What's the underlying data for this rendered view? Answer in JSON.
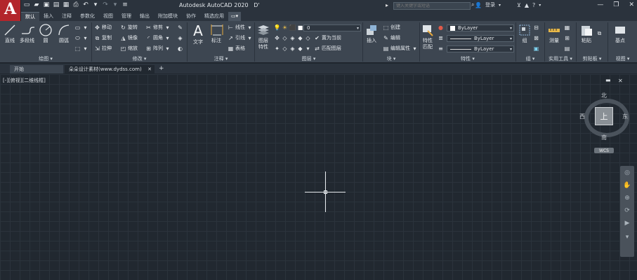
{
  "app": {
    "logo_letter": "A",
    "title": "Autodesk AutoCAD 2020",
    "title_suffix": "D'",
    "search_placeholder": "键入关键字或短语",
    "login_label": "登录"
  },
  "ribbon_tabs": [
    "默认",
    "插入",
    "注释",
    "参数化",
    "视图",
    "管理",
    "输出",
    "附加模块",
    "协作",
    "精选应用"
  ],
  "active_tab_index": 0,
  "draw_panel": {
    "title": "绘图",
    "line": "直线",
    "polyline": "多段线",
    "circle": "圆",
    "arc": "圆弧"
  },
  "modify_panel": {
    "title": "修改",
    "move": "移动",
    "rotate": "旋转",
    "trim": "修剪",
    "copy": "复制",
    "mirror": "镜像",
    "fillet": "圆角",
    "stretch": "拉伸",
    "scale": "缩放",
    "array": "阵列"
  },
  "annotation_panel": {
    "title": "注释",
    "text": "文字",
    "dimension": "标注",
    "linear": "线性",
    "leader": "引线",
    "table": "表格"
  },
  "layers_panel": {
    "title": "图层",
    "layer_properties": "图层\n特性",
    "layer_value": "0",
    "make_current": "置为当前",
    "match_layer": "匹配图层"
  },
  "block_panel": {
    "title": "块",
    "insert": "插入",
    "create": "创建",
    "edit": "编辑",
    "edit_attributes": "编辑属性"
  },
  "properties_panel": {
    "title": "特性",
    "match_properties": "特性\n匹配",
    "color": "ByLayer",
    "linetype": "ByLayer",
    "lineweight": "ByLayer"
  },
  "groups_panel": {
    "title": "组",
    "group": "组"
  },
  "utilities_panel": {
    "title": "实用工具",
    "measure": "测量"
  },
  "clipboard_panel": {
    "title": "剪贴板",
    "paste": "粘贴"
  },
  "view_panel": {
    "title": "视图",
    "base": "基点"
  },
  "file_tabs": [
    "开始",
    "朵朵设计素材(www.dydss.com)"
  ],
  "viewport_label": "[-][俯视][二维线框]",
  "viewcube": {
    "face": "上",
    "north": "北",
    "south": "南",
    "east": "东",
    "west": "西",
    "wcs": "WCS"
  },
  "colors": {
    "title_bar": "#2b333d",
    "ribbon": "#3d4651",
    "canvas": "#212830",
    "logo": "#b3262b"
  }
}
